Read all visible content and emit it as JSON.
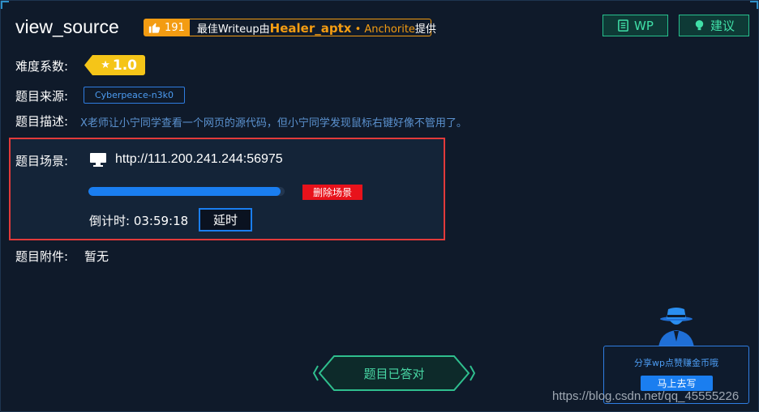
{
  "challenge": {
    "title": "view_source",
    "writeup": {
      "likes": "191",
      "prefix": "最佳Writeup由",
      "author": "Healer_aptx",
      "dot": "•",
      "second": "Anchorite",
      "suffix": "提供"
    },
    "buttons": {
      "wp": "WP",
      "suggest": "建议"
    },
    "difficulty_label": "难度系数:",
    "difficulty_value": "1.0",
    "source_label": "题目来源:",
    "source_value": "Cyberpeace-n3k0",
    "desc_label": "题目描述:",
    "desc_value": "X老师让小宁同学查看一个网页的源代码，但小宁同学发现鼠标右键好像不管用了。",
    "scene": {
      "label": "题目场景:",
      "url": "http://111.200.241.244:56975",
      "progress_percent": 98,
      "delete_button": "删除场景",
      "countdown_label": "倒计时: 03:59:18",
      "delay_button": "延时"
    },
    "attachment_label": "题目附件:",
    "attachment_value": "暂无",
    "answered_button": "题目已答对",
    "share": {
      "text": "分享wp点赞赚金币哦",
      "button": "马上去写"
    },
    "watermark": "https://blog.csdn.net/qq_45555226"
  },
  "colors": {
    "background": "#0f1a2a",
    "accent_orange": "#f39c12",
    "accent_green": "#27c08d",
    "accent_blue": "#1a7ef0",
    "danger_red": "#e8121b",
    "highlight_box": "#e23a3a"
  },
  "icons": {
    "likes": "thumbs-up-icon",
    "wp": "book-icon",
    "suggest": "bulb-icon",
    "difficulty": "star-icon",
    "scene": "monitor-icon",
    "share": "hacker-avatar-icon"
  }
}
